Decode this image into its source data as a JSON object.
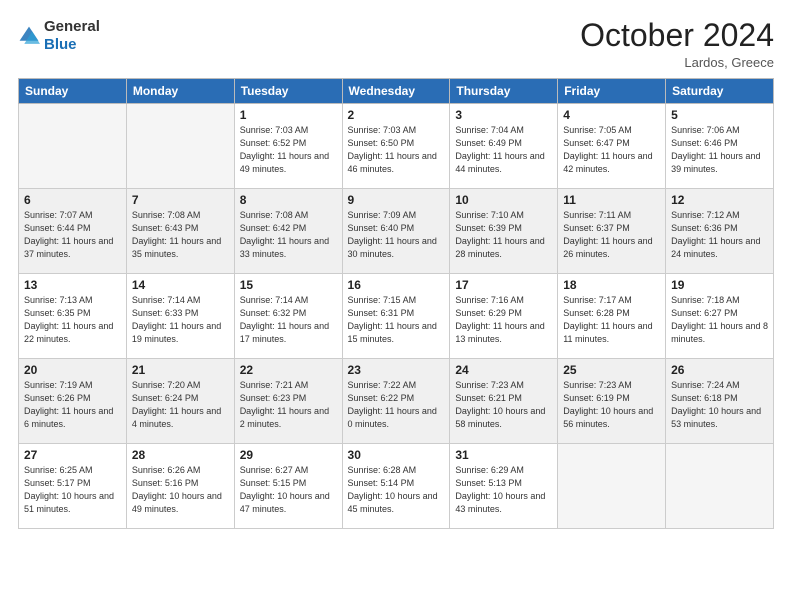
{
  "header": {
    "logo_general": "General",
    "logo_blue": "Blue",
    "month_title": "October 2024",
    "location": "Lardos, Greece"
  },
  "weekdays": [
    "Sunday",
    "Monday",
    "Tuesday",
    "Wednesday",
    "Thursday",
    "Friday",
    "Saturday"
  ],
  "weeks": [
    [
      {
        "day": "",
        "info": ""
      },
      {
        "day": "",
        "info": ""
      },
      {
        "day": "1",
        "info": "Sunrise: 7:03 AM\nSunset: 6:52 PM\nDaylight: 11 hours and 49 minutes."
      },
      {
        "day": "2",
        "info": "Sunrise: 7:03 AM\nSunset: 6:50 PM\nDaylight: 11 hours and 46 minutes."
      },
      {
        "day": "3",
        "info": "Sunrise: 7:04 AM\nSunset: 6:49 PM\nDaylight: 11 hours and 44 minutes."
      },
      {
        "day": "4",
        "info": "Sunrise: 7:05 AM\nSunset: 6:47 PM\nDaylight: 11 hours and 42 minutes."
      },
      {
        "day": "5",
        "info": "Sunrise: 7:06 AM\nSunset: 6:46 PM\nDaylight: 11 hours and 39 minutes."
      }
    ],
    [
      {
        "day": "6",
        "info": "Sunrise: 7:07 AM\nSunset: 6:44 PM\nDaylight: 11 hours and 37 minutes."
      },
      {
        "day": "7",
        "info": "Sunrise: 7:08 AM\nSunset: 6:43 PM\nDaylight: 11 hours and 35 minutes."
      },
      {
        "day": "8",
        "info": "Sunrise: 7:08 AM\nSunset: 6:42 PM\nDaylight: 11 hours and 33 minutes."
      },
      {
        "day": "9",
        "info": "Sunrise: 7:09 AM\nSunset: 6:40 PM\nDaylight: 11 hours and 30 minutes."
      },
      {
        "day": "10",
        "info": "Sunrise: 7:10 AM\nSunset: 6:39 PM\nDaylight: 11 hours and 28 minutes."
      },
      {
        "day": "11",
        "info": "Sunrise: 7:11 AM\nSunset: 6:37 PM\nDaylight: 11 hours and 26 minutes."
      },
      {
        "day": "12",
        "info": "Sunrise: 7:12 AM\nSunset: 6:36 PM\nDaylight: 11 hours and 24 minutes."
      }
    ],
    [
      {
        "day": "13",
        "info": "Sunrise: 7:13 AM\nSunset: 6:35 PM\nDaylight: 11 hours and 22 minutes."
      },
      {
        "day": "14",
        "info": "Sunrise: 7:14 AM\nSunset: 6:33 PM\nDaylight: 11 hours and 19 minutes."
      },
      {
        "day": "15",
        "info": "Sunrise: 7:14 AM\nSunset: 6:32 PM\nDaylight: 11 hours and 17 minutes."
      },
      {
        "day": "16",
        "info": "Sunrise: 7:15 AM\nSunset: 6:31 PM\nDaylight: 11 hours and 15 minutes."
      },
      {
        "day": "17",
        "info": "Sunrise: 7:16 AM\nSunset: 6:29 PM\nDaylight: 11 hours and 13 minutes."
      },
      {
        "day": "18",
        "info": "Sunrise: 7:17 AM\nSunset: 6:28 PM\nDaylight: 11 hours and 11 minutes."
      },
      {
        "day": "19",
        "info": "Sunrise: 7:18 AM\nSunset: 6:27 PM\nDaylight: 11 hours and 8 minutes."
      }
    ],
    [
      {
        "day": "20",
        "info": "Sunrise: 7:19 AM\nSunset: 6:26 PM\nDaylight: 11 hours and 6 minutes."
      },
      {
        "day": "21",
        "info": "Sunrise: 7:20 AM\nSunset: 6:24 PM\nDaylight: 11 hours and 4 minutes."
      },
      {
        "day": "22",
        "info": "Sunrise: 7:21 AM\nSunset: 6:23 PM\nDaylight: 11 hours and 2 minutes."
      },
      {
        "day": "23",
        "info": "Sunrise: 7:22 AM\nSunset: 6:22 PM\nDaylight: 11 hours and 0 minutes."
      },
      {
        "day": "24",
        "info": "Sunrise: 7:23 AM\nSunset: 6:21 PM\nDaylight: 10 hours and 58 minutes."
      },
      {
        "day": "25",
        "info": "Sunrise: 7:23 AM\nSunset: 6:19 PM\nDaylight: 10 hours and 56 minutes."
      },
      {
        "day": "26",
        "info": "Sunrise: 7:24 AM\nSunset: 6:18 PM\nDaylight: 10 hours and 53 minutes."
      }
    ],
    [
      {
        "day": "27",
        "info": "Sunrise: 6:25 AM\nSunset: 5:17 PM\nDaylight: 10 hours and 51 minutes."
      },
      {
        "day": "28",
        "info": "Sunrise: 6:26 AM\nSunset: 5:16 PM\nDaylight: 10 hours and 49 minutes."
      },
      {
        "day": "29",
        "info": "Sunrise: 6:27 AM\nSunset: 5:15 PM\nDaylight: 10 hours and 47 minutes."
      },
      {
        "day": "30",
        "info": "Sunrise: 6:28 AM\nSunset: 5:14 PM\nDaylight: 10 hours and 45 minutes."
      },
      {
        "day": "31",
        "info": "Sunrise: 6:29 AM\nSunset: 5:13 PM\nDaylight: 10 hours and 43 minutes."
      },
      {
        "day": "",
        "info": ""
      },
      {
        "day": "",
        "info": ""
      }
    ]
  ]
}
